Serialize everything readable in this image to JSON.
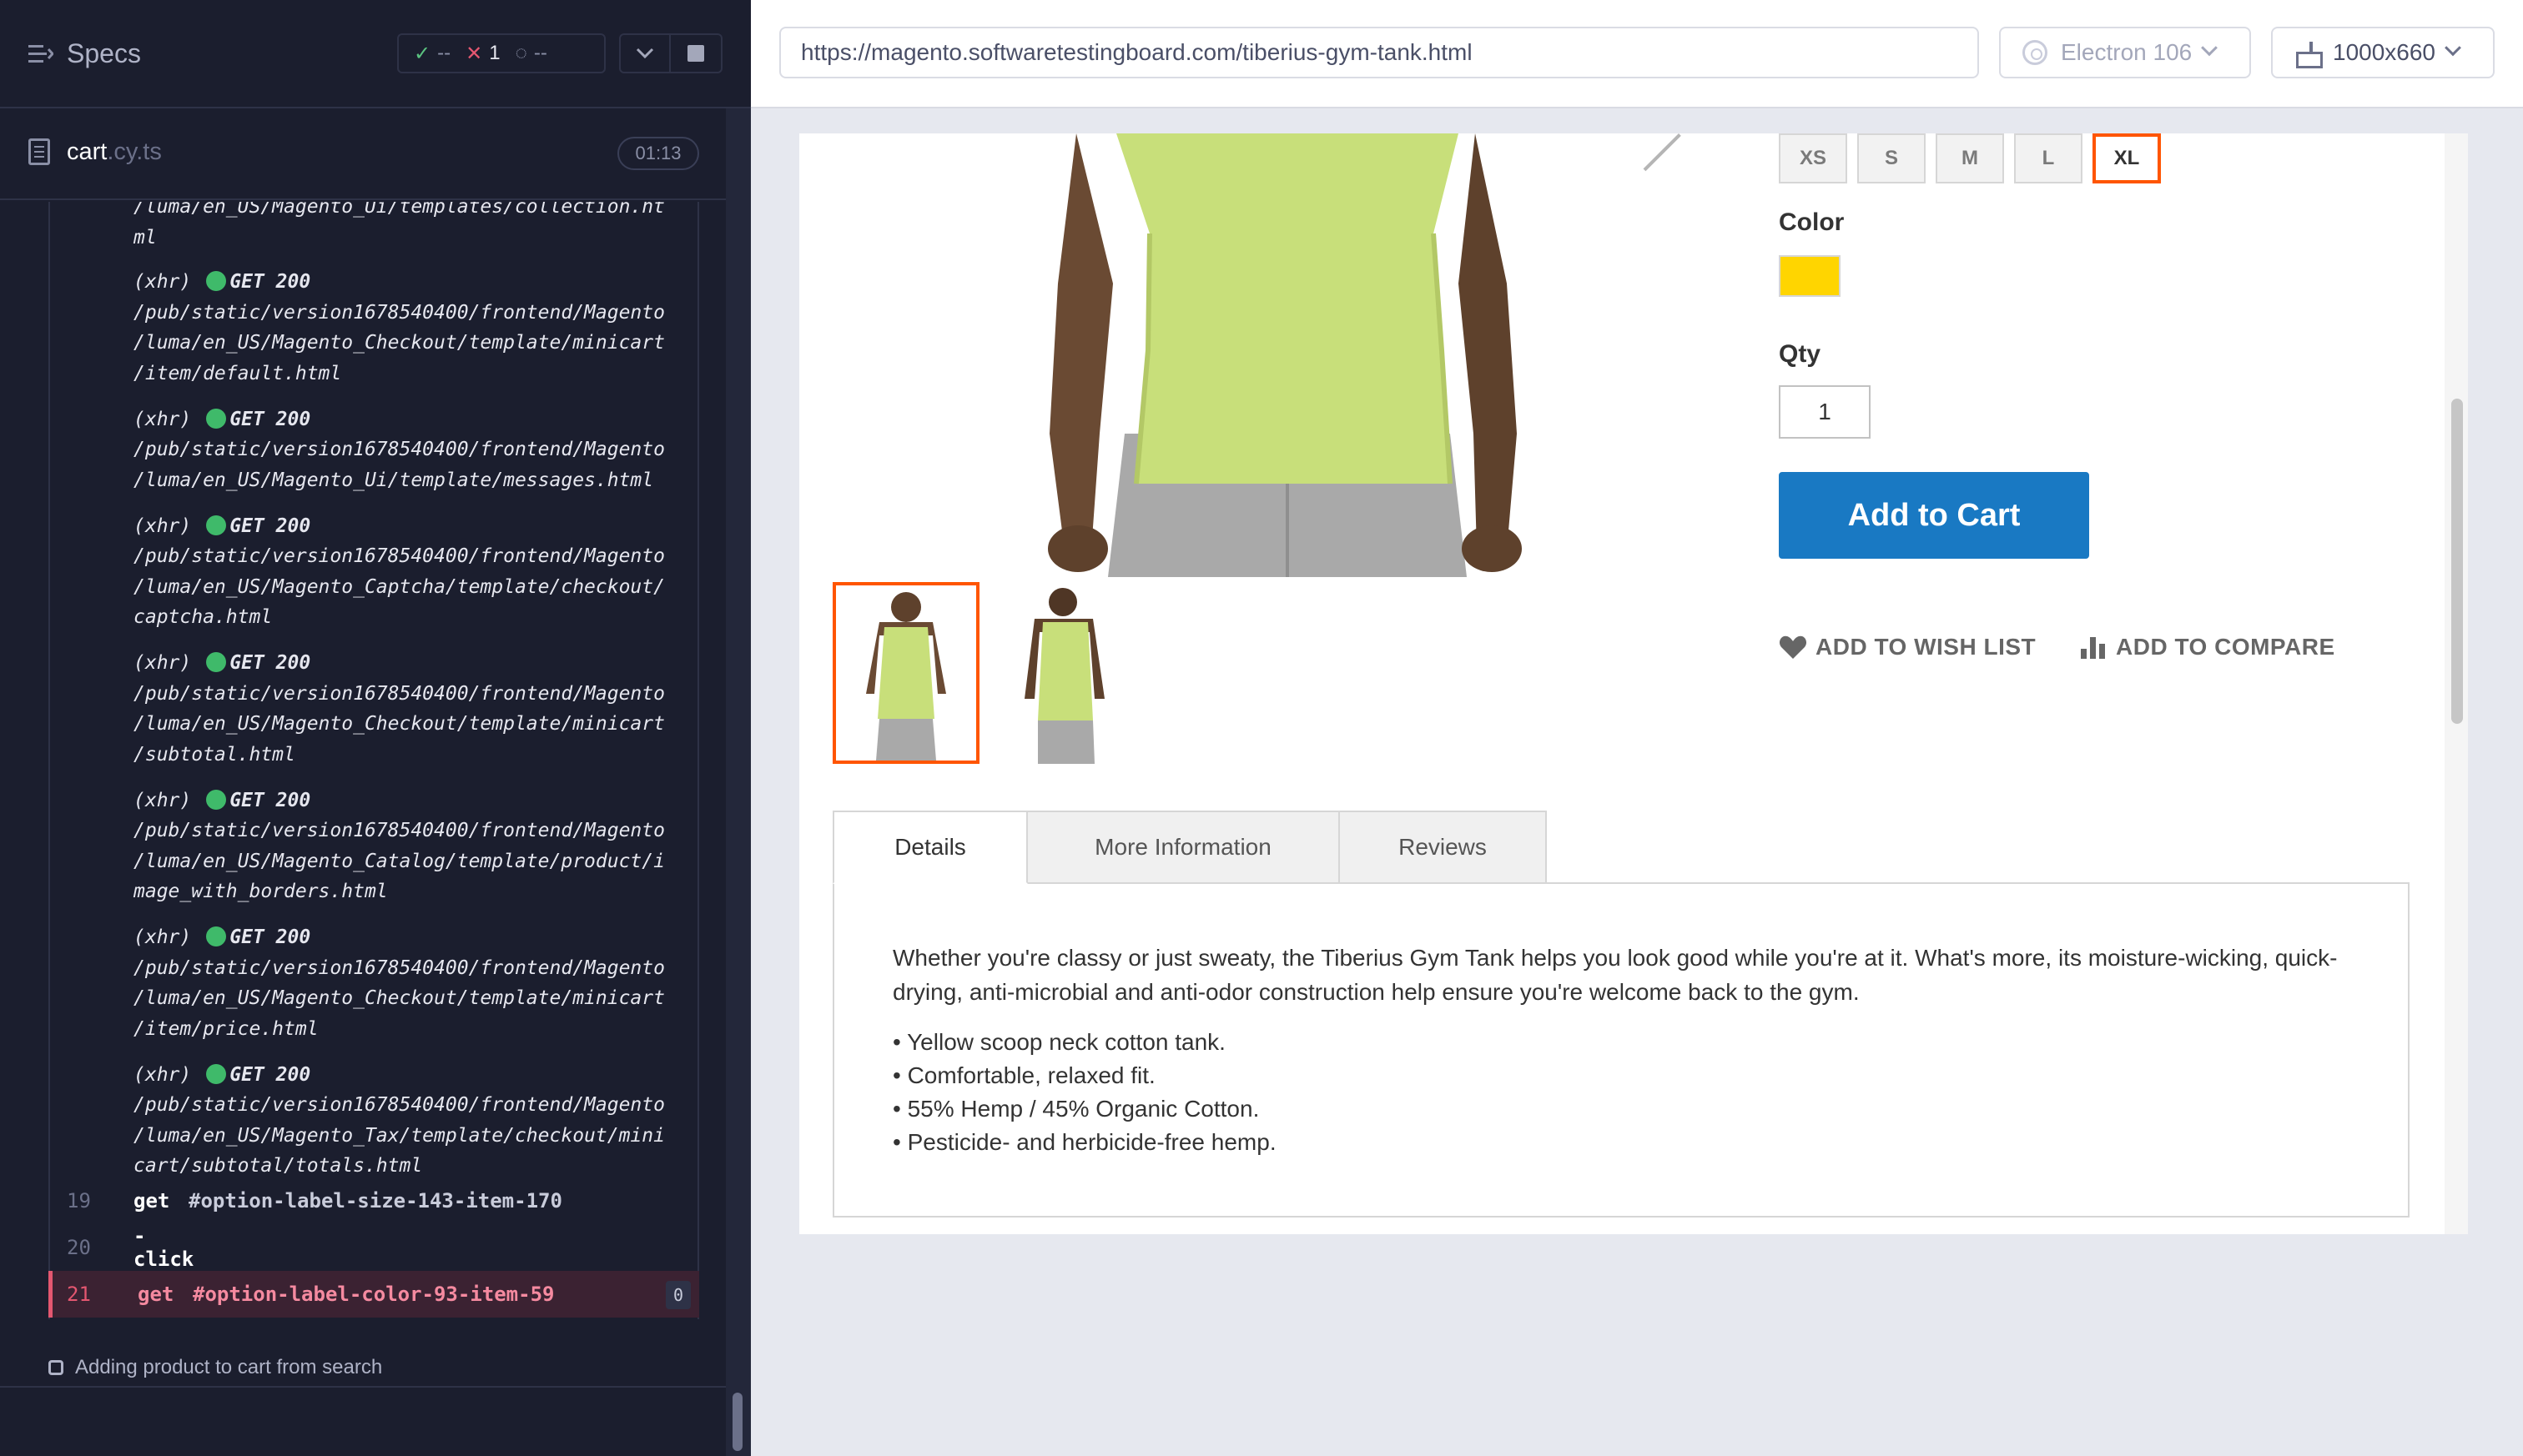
{
  "runner": {
    "specs_label": "Specs",
    "stats": {
      "passed": "--",
      "failed": "1",
      "pending": "--"
    },
    "spec": {
      "name": "cart",
      "ext": ".cy.ts",
      "time": "01:13"
    },
    "log_top_fragment": [
      "/luma/en_US/Magento_Ui/templates/collection.ht",
      "ml"
    ],
    "xhr_entries": [
      {
        "label": "(xhr)",
        "verb": "GET 200",
        "lines": [
          "/pub/static/version1678540400/frontend/Magento",
          "/luma/en_US/Magento_Checkout/template/minicart",
          "/item/default.html"
        ]
      },
      {
        "label": "(xhr)",
        "verb": "GET 200",
        "lines": [
          "/pub/static/version1678540400/frontend/Magento",
          "/luma/en_US/Magento_Ui/template/messages.html"
        ]
      },
      {
        "label": "(xhr)",
        "verb": "GET 200",
        "lines": [
          "/pub/static/version1678540400/frontend/Magento",
          "/luma/en_US/Magento_Captcha/template/checkout/",
          "captcha.html"
        ]
      },
      {
        "label": "(xhr)",
        "verb": "GET 200",
        "lines": [
          "/pub/static/version1678540400/frontend/Magento",
          "/luma/en_US/Magento_Checkout/template/minicart",
          "/subtotal.html"
        ]
      },
      {
        "label": "(xhr)",
        "verb": "GET 200",
        "lines": [
          "/pub/static/version1678540400/frontend/Magento",
          "/luma/en_US/Magento_Catalog/template/product/i",
          "mage_with_borders.html"
        ]
      },
      {
        "label": "(xhr)",
        "verb": "GET 200",
        "lines": [
          "/pub/static/version1678540400/frontend/Magento",
          "/luma/en_US/Magento_Checkout/template/minicart",
          "/item/price.html"
        ]
      },
      {
        "label": "(xhr)",
        "verb": "GET 200",
        "lines": [
          "/pub/static/version1678540400/frontend/Magento",
          "/luma/en_US/Magento_Tax/template/checkout/mini",
          "cart/subtotal/totals.html"
        ]
      }
    ],
    "commands": [
      {
        "num": "19",
        "name": "get",
        "arg": "#option-label-size-143-item-170"
      },
      {
        "num": "20",
        "name": "-click",
        "arg": ""
      },
      {
        "num": "21",
        "name": "get",
        "arg": "#option-label-color-93-item-59",
        "badge": "0"
      }
    ],
    "test_title": "Adding product to cart from search"
  },
  "topbar": {
    "url": "https://magento.softwaretestingboard.com/tiberius-gym-tank.html",
    "browser": "Electron 106",
    "viewport": "1000x660"
  },
  "product": {
    "sizes": [
      "XS",
      "S",
      "M",
      "L",
      "XL"
    ],
    "selected_size": "XL",
    "color_label": "Color",
    "swatch_color": "#ffd500",
    "qty_label": "Qty",
    "qty_value": "1",
    "add_to_cart": "Add to Cart",
    "wishlist": "ADD TO WISH LIST",
    "compare": "ADD TO COMPARE",
    "accent": "#1979c3",
    "tabs": [
      "Details",
      "More Information",
      "Reviews"
    ],
    "description": "Whether you're classy or just sweaty, the Tiberius Gym Tank helps you look good while you're at it. What's more, its moisture-wicking, quick-drying, anti-microbial and anti-odor construction help ensure you're welcome back to the gym.",
    "bullets": [
      "• Yellow scoop neck cotton tank.",
      "• Comfortable, relaxed fit.",
      "• 55% Hemp / 45% Organic Cotton.",
      "• Pesticide- and herbicide-free hemp."
    ]
  }
}
